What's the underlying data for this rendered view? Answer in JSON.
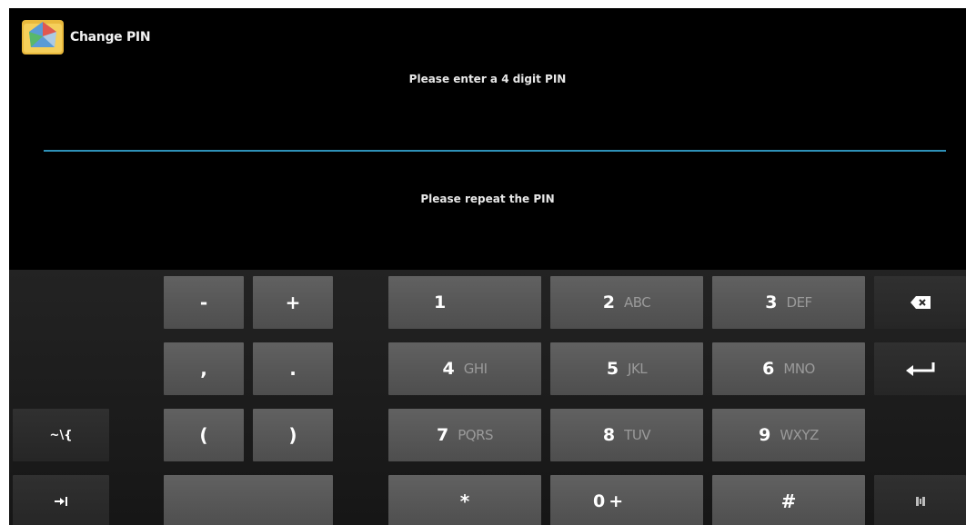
{
  "title_bar": {
    "app_icon": "android-folder-icon",
    "title": "Change PIN"
  },
  "dialog": {
    "enter_prompt": "Please enter a 4 digit PIN",
    "pin_value": "",
    "repeat_prompt": "Please repeat the PIN",
    "repeat_value": ""
  },
  "colors": {
    "background": "#000000",
    "accent_underline": "#2e91b8",
    "key": "#585858",
    "key_dark": "#2c2c2c"
  },
  "keyboard": {
    "symbols_key": "~\\{",
    "tab_key_icon": "tab-icon",
    "minus": "-",
    "plus": "+",
    "comma": ",",
    "period": ".",
    "open_paren": "(",
    "close_paren": ")",
    "space_key": "",
    "digits": [
      {
        "digit": "1",
        "letters": ""
      },
      {
        "digit": "2",
        "letters": "ABC"
      },
      {
        "digit": "3",
        "letters": "DEF"
      },
      {
        "digit": "4",
        "letters": "GHI"
      },
      {
        "digit": "5",
        "letters": "JKL"
      },
      {
        "digit": "6",
        "letters": "MNO"
      },
      {
        "digit": "7",
        "letters": "PQRS"
      },
      {
        "digit": "8",
        "letters": "TUV"
      },
      {
        "digit": "9",
        "letters": "WXYZ"
      }
    ],
    "star": "*",
    "zero": "0",
    "zero_sub": "+",
    "hash": "#",
    "backspace_icon": "backspace-icon",
    "enter_icon": "enter-icon",
    "settings_icon": "keyboard-settings-icon"
  }
}
